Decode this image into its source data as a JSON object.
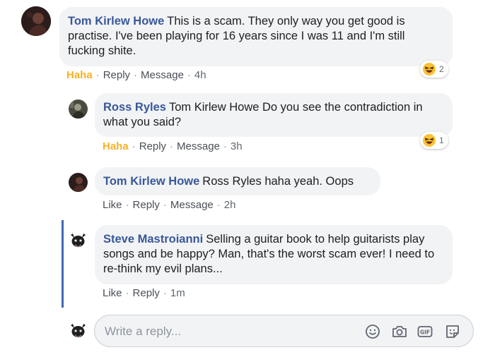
{
  "comments": [
    {
      "author": "Tom Kirlew Howe",
      "text": "This is a scam. They only way you get good is practise. I've been playing for 16 years since I was 11 and I'm still fucking shite.",
      "reaction": "Haha",
      "actions": [
        "Reply",
        "Message"
      ],
      "time": "4h",
      "reaction_icon": "laughing-emoji",
      "reaction_count": "2"
    },
    {
      "author": "Ross Ryles",
      "text": "Tom Kirlew Howe Do you see the contradiction in what you said?",
      "reaction": "Haha",
      "actions": [
        "Reply",
        "Message"
      ],
      "time": "3h",
      "reaction_icon": "laughing-emoji",
      "reaction_count": "1"
    },
    {
      "author": "Tom Kirlew Howe",
      "text": "Ross Ryles haha yeah. Oops",
      "reaction": "Like",
      "actions": [
        "Reply",
        "Message"
      ],
      "time": "2h"
    },
    {
      "author": "Steve Mastroianni",
      "text": "Selling a guitar book to help guitarists play songs and be happy? Man, that's the worst scam ever! I need to re-think my evil plans...",
      "reaction": "Like",
      "actions": [
        "Reply"
      ],
      "time": "1m"
    }
  ],
  "reply_box": {
    "placeholder": "Write a reply...",
    "tools": [
      "emoji-icon",
      "camera-icon",
      "gif-icon",
      "sticker-icon"
    ]
  },
  "colors": {
    "link": "#385898",
    "haha": "#f7b125",
    "bubble": "#f2f3f5",
    "thread_line": "#4267b2"
  }
}
